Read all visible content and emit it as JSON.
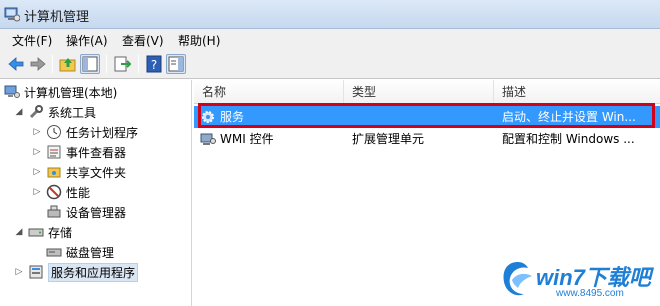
{
  "window": {
    "title": "计算机管理"
  },
  "menu": [
    {
      "label": "文件(F)"
    },
    {
      "label": "操作(A)"
    },
    {
      "label": "查看(V)"
    },
    {
      "label": "帮助(H)"
    }
  ],
  "toolbar": {
    "buttons": [
      "back-arrow-icon",
      "forward-arrow-icon",
      "up-folder-icon",
      "show-hide-tree-icon",
      "export-list-icon",
      "help-icon",
      "properties-icon"
    ]
  },
  "tree": {
    "items": [
      {
        "label": "计算机管理(本地)",
        "icon": "computer-icon",
        "twisty": ""
      },
      {
        "label": "系统工具",
        "icon": "tools-icon",
        "twisty": "◢"
      },
      {
        "label": "任务计划程序",
        "icon": "clock-icon",
        "twisty": "▷"
      },
      {
        "label": "事件查看器",
        "icon": "event-viewer-icon",
        "twisty": "▷"
      },
      {
        "label": "共享文件夹",
        "icon": "shared-folder-icon",
        "twisty": "▷"
      },
      {
        "label": "性能",
        "icon": "performance-icon",
        "twisty": "▷"
      },
      {
        "label": "设备管理器",
        "icon": "device-manager-icon",
        "twisty": ""
      },
      {
        "label": "存储",
        "icon": "storage-icon",
        "twisty": "◢"
      },
      {
        "label": "磁盘管理",
        "icon": "disk-icon",
        "twisty": ""
      },
      {
        "label": "服务和应用程序",
        "icon": "services-apps-icon",
        "twisty": "▷"
      }
    ]
  },
  "list": {
    "columns": [
      "名称",
      "类型",
      "描述"
    ],
    "rows": [
      {
        "name": "服务",
        "type": "",
        "description": "启动、终止并设置 Win...",
        "icon": "gear-icon"
      },
      {
        "name": "WMI 控件",
        "type": "扩展管理单元",
        "description": "配置和控制 Windows ...",
        "icon": "wmi-icon"
      }
    ]
  },
  "watermark": {
    "text": "win7下载吧",
    "url": "www.8495.com"
  },
  "colors": {
    "selection": "#3399ff",
    "highlight_border": "#d0021b",
    "watermark": "#1e7fd6"
  }
}
